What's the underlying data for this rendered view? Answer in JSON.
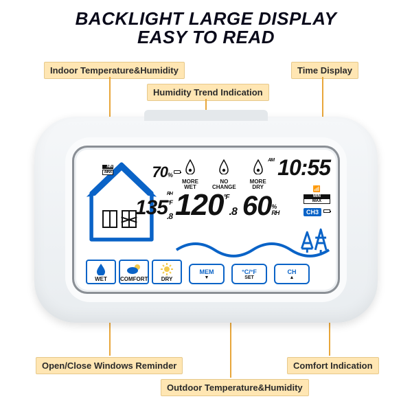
{
  "headline1": "BACKLIGHT LARGE DISPLAY",
  "headline2": "EASY TO READ",
  "labels": {
    "indoor": "Indoor Temperature&Humidity",
    "trend": "Humidity Trend Indication",
    "time": "Time Display",
    "windows": "Open/Close Windows Reminder",
    "outdoor": "Outdoor Temperature&Humidity",
    "comfort": "Comfort Indication"
  },
  "indoor": {
    "min_label": "MIN",
    "max_label": "MAX",
    "humidity": "70",
    "humidity_unit_pct": "%",
    "humidity_unit_rh": "RH",
    "temp_int": "135",
    "temp_dec": ".8",
    "temp_unit": "°F"
  },
  "trend": {
    "more_wet": "MORE\nWET",
    "no_change": "NO\nCHANGE",
    "more_dry": "MORE\nDRY"
  },
  "clock": {
    "ampm": "AM",
    "time": "10:55"
  },
  "outdoor": {
    "temp_int": "120",
    "temp_dec": ".8",
    "temp_unit": "°F",
    "humidity": "60",
    "hum_pct": "%",
    "hum_rh": "RH"
  },
  "rx": {
    "min": "MIN",
    "max": "MAX",
    "ch": "CH3"
  },
  "comfort": {
    "wet": "WET",
    "comfort": "COMFORT",
    "dry": "DRY"
  },
  "buttons": {
    "mem_top": "MEM",
    "mem_sub": "▼",
    "cf_top": "°C/°F",
    "cf_sub": "SET",
    "ch_top": "CH",
    "ch_sub": "▲"
  }
}
